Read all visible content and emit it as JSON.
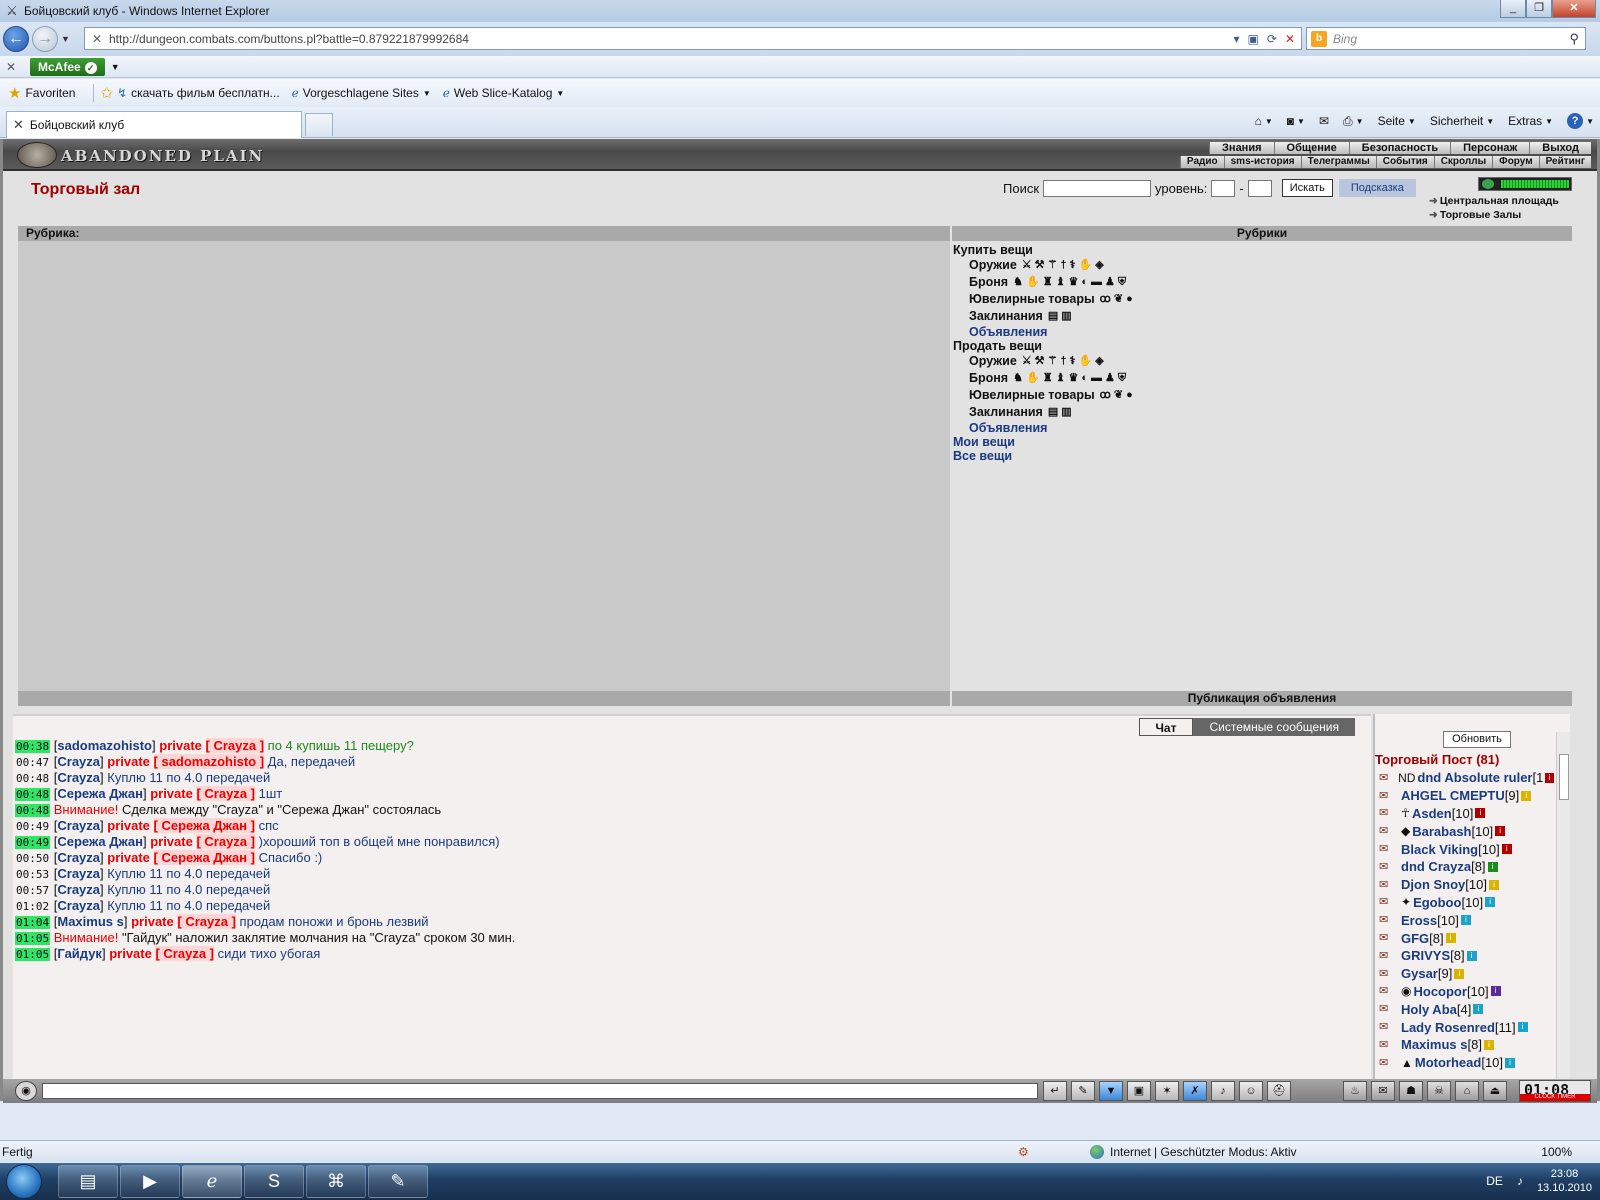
{
  "window": {
    "title": "Бойцовский клуб - Windows Internet Explorer"
  },
  "address": {
    "url": "http://dungeon.combats.com/buttons.pl?battle=0.879221879992684",
    "search_placeholder": "Bing"
  },
  "toolbar": {
    "mcafee": "McAfee"
  },
  "favorites": {
    "favoriten": "Favoriten",
    "items": [
      "скачать фильм бесплатн...",
      "Vorgeschlagene Sites",
      "Web Slice-Katalog"
    ]
  },
  "tab": {
    "title": "Бойцовский клуб"
  },
  "commandbar": {
    "seite": "Seite",
    "sicherheit": "Sicherheit",
    "extras": "Extras"
  },
  "game": {
    "logo": "ABANDONED PLAIN",
    "menu_top": [
      "Знания",
      "Общение",
      "Безопасность",
      "Персонаж",
      "Выход"
    ],
    "menu_bottom": [
      "Радио",
      "sms-история",
      "Телеграммы",
      "События",
      "Скроллы",
      "Форум",
      "Рейтинг"
    ],
    "shop_title": "Торговый зал",
    "search_label": "Поиск",
    "level_label": "уровень:",
    "level_dash": "-",
    "search_button": "Искать",
    "hint_button": "Подсказка",
    "nav_links": [
      "Центральная площадь",
      "Торговые Залы"
    ],
    "rubrika_label": "Рубрика:",
    "rubriki_label": "Рубрики",
    "publication_label": "Публикация объявления",
    "buy": "Купить вещи",
    "sell": "Продать вещи",
    "weapons": "Оружие",
    "armor": "Броня",
    "jewelry": "Ювелирные товары",
    "spells": "Заклинания",
    "ads": "Объявления",
    "my_items": "Мои вещи",
    "all_items": "Все вещи"
  },
  "chat": {
    "tab_chat": "Чат",
    "tab_system": "Системные сообщения",
    "lines": [
      {
        "time": "00:38",
        "hl": true,
        "nick": "sadomazohisto",
        "private": "Crayza",
        "text": "по 4 купишь 11 пещеру?",
        "color": "green"
      },
      {
        "time": "00:47",
        "hl": false,
        "nick": "Crayza",
        "private": "sadomazohisto",
        "text": "Да, передачей",
        "color": "blue"
      },
      {
        "time": "00:48",
        "hl": false,
        "nick": "Crayza",
        "private": "",
        "text": "Куплю 11 по 4.0 передачей",
        "color": "blue"
      },
      {
        "time": "00:48",
        "hl": true,
        "nick": "Сережа Джан",
        "private": "Crayza",
        "text": "1шт",
        "color": "blue"
      },
      {
        "time": "00:48",
        "hl": true,
        "nick": "",
        "warn": "Внимание!",
        "private": "",
        "text": "Сделка между \"Crayza\" и \"Сережа Джан\" состоялась",
        "color": "black"
      },
      {
        "time": "00:49",
        "hl": false,
        "nick": "Crayza",
        "private": "Сережа Джан",
        "text": "спс",
        "color": "blue"
      },
      {
        "time": "00:49",
        "hl": true,
        "nick": "Сережа Джан",
        "private": "Crayza",
        "text": ")хороший топ в общей мне понравился)",
        "color": "blue"
      },
      {
        "time": "00:50",
        "hl": false,
        "nick": "Crayza",
        "private": "Сережа Джан",
        "text": "Спасибо :)",
        "color": "blue"
      },
      {
        "time": "00:53",
        "hl": false,
        "nick": "Crayza",
        "private": "",
        "text": "Куплю 11 по 4.0 передачей",
        "color": "blue"
      },
      {
        "time": "00:57",
        "hl": false,
        "nick": "Crayza",
        "private": "",
        "text": "Куплю 11 по 4.0 передачей",
        "color": "blue"
      },
      {
        "time": "01:02",
        "hl": false,
        "nick": "Crayza",
        "private": "",
        "text": "Куплю 11 по 4.0 передачей",
        "color": "blue"
      },
      {
        "time": "01:04",
        "hl": true,
        "nick": "Maximus s",
        "private": "Crayza",
        "text": "продам поножи и бронь лезвий",
        "color": "blue"
      },
      {
        "time": "01:05",
        "hl": true,
        "nick": "",
        "warn": "Внимание!",
        "private": "",
        "text": "\"Гайдук\" наложил заклятие молчания на \"Crayza\" сроком 30 мин.",
        "color": "black"
      },
      {
        "time": "01:05",
        "hl": true,
        "nick": "Гайдук",
        "private": "Crayza",
        "text": "сиди тихо убогая",
        "color": "blue"
      }
    ]
  },
  "online": {
    "refresh": "Обновить",
    "title": "Торговый Пост (81)",
    "users": [
      {
        "clan": "ND",
        "name": "dnd Absolute ruler",
        "level": "[1",
        "info_color": "#b00000"
      },
      {
        "clan": "",
        "name": "AHGEL CMEPTU",
        "level": "[9]",
        "info_color": "#d9b400"
      },
      {
        "clan": "☥",
        "name": "Asden",
        "level": "[10]",
        "info_color": "#b00000"
      },
      {
        "clan": "◆",
        "name": "Barabash",
        "level": "[10]",
        "info_color": "#b00000"
      },
      {
        "clan": "",
        "name": "Black Viking",
        "level": "[10]",
        "info_color": "#b00000"
      },
      {
        "clan": "",
        "name": "dnd Crayza",
        "level": "[8]",
        "info_color": "#1f8a1f"
      },
      {
        "clan": "",
        "name": "Djon Snoy",
        "level": "[10]",
        "info_color": "#d9b400"
      },
      {
        "clan": "✦",
        "name": "Egoboo",
        "level": "[10]",
        "info_color": "#1ca3c8"
      },
      {
        "clan": "",
        "name": "Eross",
        "level": "[10]",
        "info_color": "#1ca3c8"
      },
      {
        "clan": "",
        "name": "GFG",
        "level": "[8]",
        "info_color": "#d9b400"
      },
      {
        "clan": "",
        "name": "GRIVYS",
        "level": "[8]",
        "info_color": "#1ca3c8"
      },
      {
        "clan": "",
        "name": "Gysar",
        "level": "[9]",
        "info_color": "#d9b400"
      },
      {
        "clan": "◉",
        "name": "Hocopor",
        "level": "[10]",
        "info_color": "#5a2a9a"
      },
      {
        "clan": "",
        "name": "Holy Aba",
        "level": "[4]",
        "info_color": "#1ca3c8"
      },
      {
        "clan": "",
        "name": "Lady Rosenred",
        "level": "[11]",
        "info_color": "#1ca3c8"
      },
      {
        "clan": "",
        "name": "Maximus s",
        "level": "[8]",
        "info_color": "#d9b400"
      },
      {
        "clan": "▲",
        "name": "Motorhead",
        "level": "[10]",
        "info_color": "#1ca3c8"
      }
    ]
  },
  "clock": {
    "time": "01:08",
    "labels": "CLOCK TIMER"
  },
  "status": {
    "left": "Fertig",
    "zone": "Internet | Geschützter Modus: Aktiv",
    "zoom": "100%"
  },
  "taskbar": {
    "lang": "DE",
    "time": "23:08",
    "date": "13.10.2010"
  }
}
